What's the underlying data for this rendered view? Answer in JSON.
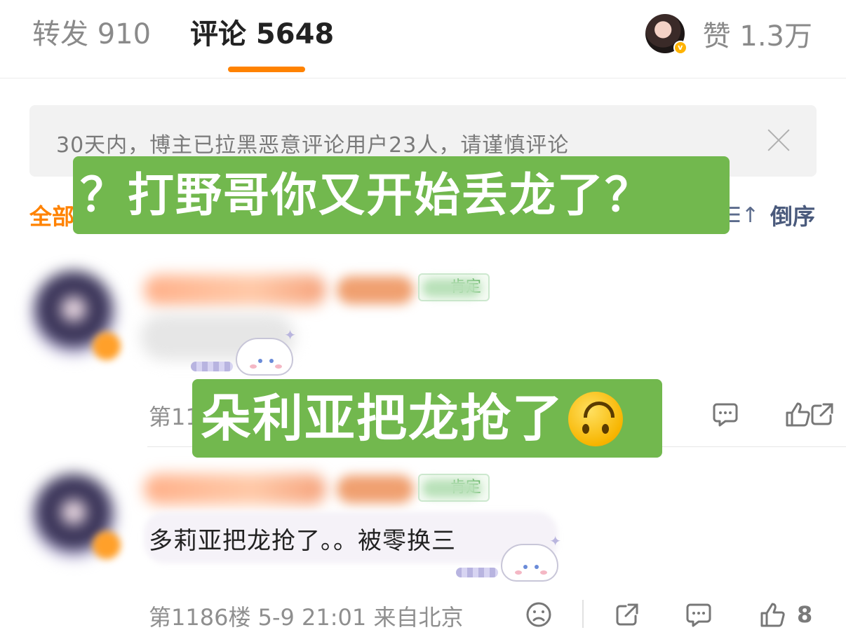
{
  "tabs": {
    "forward_label": "转发 910",
    "comment_label": "评论 5648",
    "like_label": "赞 1.3万"
  },
  "notice": {
    "text": "30天内，博主已拉黑恶意评论用户23人，请谨慎评论"
  },
  "filter": {
    "all_label": "全部",
    "sort_label": "倒序"
  },
  "captions": {
    "top": "？打野哥你又开始丢龙了？",
    "middle": "朵利亚把龙抢了"
  },
  "comments": [
    {
      "tag_label": "肯定",
      "floor_prefix": "第11",
      "like_count": ""
    },
    {
      "tag_label": "肯定",
      "text": "多莉亚把龙抢了。。被零换三",
      "meta": "第1186楼 5-9 21:01 来自北京",
      "like_count": "8"
    }
  ],
  "colors": {
    "accent": "#ff8200",
    "caption_green": "#72b84e",
    "sort_blue": "#4a5a7c"
  },
  "icons": [
    "close-icon",
    "sort-icon",
    "emoji-icon",
    "share-icon",
    "comment-icon",
    "thumb-up-icon",
    "upside-down-face-icon"
  ]
}
